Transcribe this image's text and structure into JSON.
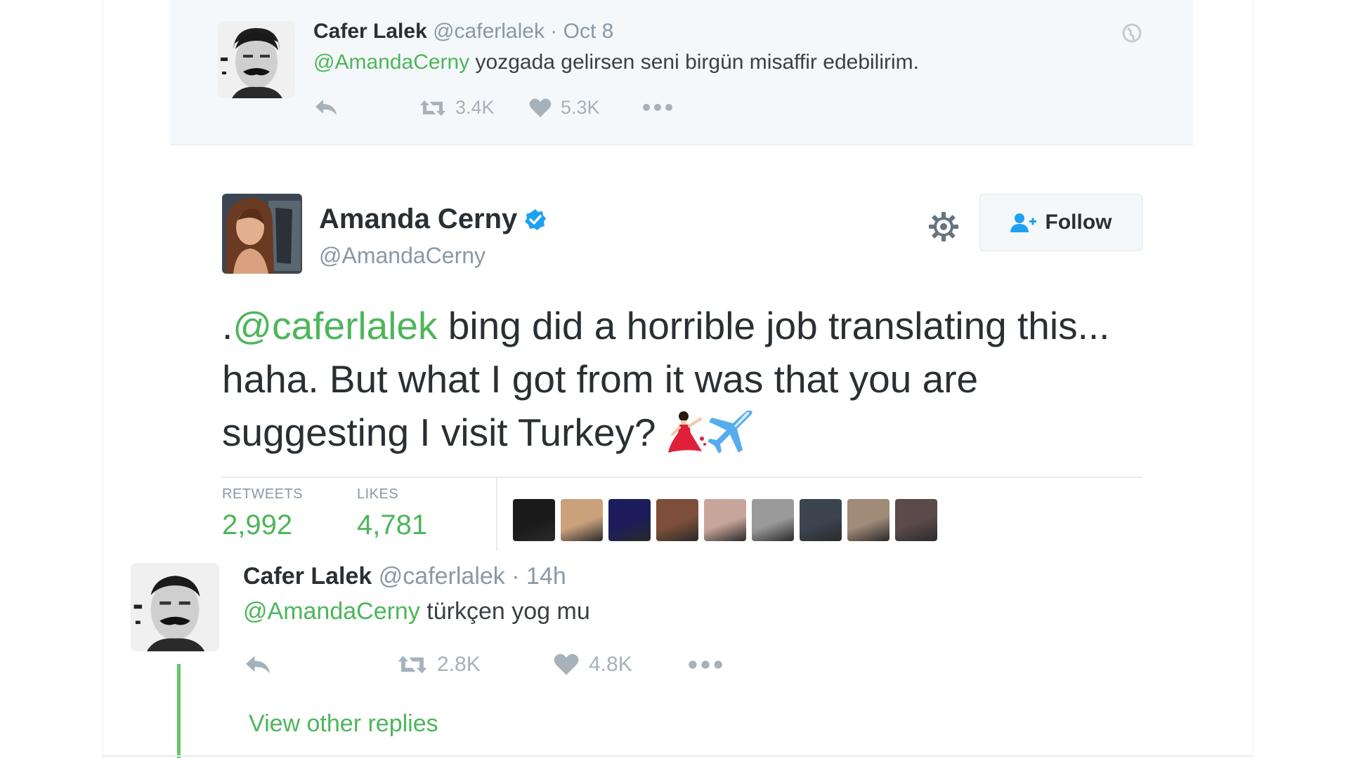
{
  "parent_tweet": {
    "name": "Cafer Lalek",
    "handle": "@caferlalek",
    "separator": "·",
    "time": "Oct 8",
    "mention": "@AmandaCerny",
    "text": " yozgada gelirsen seni birgün misaffir edebilirim.",
    "retweets": "3.4K",
    "likes": "5.3K",
    "icons": {
      "status": "globe-icon",
      "reply": "reply-icon",
      "retweet": "retweet-icon",
      "like": "heart-icon",
      "more": "more-icon"
    }
  },
  "main_tweet": {
    "name": "Amanda Cerny",
    "handle": "@AmandaCerny",
    "follow_label": "Follow",
    "text_prefix": ".",
    "mention": "@caferlalek",
    "text": "  bing did a horrible job translating this... haha. But what I got from it was that you are suggesting I visit Turkey? ",
    "stats": {
      "retweets_label": "RETWEETS",
      "retweets_value": "2,992",
      "likes_label": "LIKES",
      "likes_value": "4,781"
    },
    "icons": {
      "verified": "verified-badge-icon",
      "settings": "gear-icon",
      "follow": "add-user-icon",
      "emoji_1": "dancer-emoji-icon",
      "emoji_2": "airplane-emoji-icon"
    },
    "liker_colors": [
      "#1a1a1a",
      "#c9a27c",
      "#1c1d5a",
      "#7d4f3a",
      "#c8a59a",
      "#9a9a9a",
      "#3c4450",
      "#a08a78",
      "#5a4a4a"
    ]
  },
  "reply_tweet": {
    "name": "Cafer Lalek",
    "handle": "@caferlalek",
    "separator": "·",
    "time": "14h",
    "mention": "@AmandaCerny",
    "text": " türkçen yog mu",
    "retweets": "2.8K",
    "likes": "4.8K",
    "view_other_replies": "View other replies"
  },
  "colors": {
    "link": "#4cb65a",
    "muted": "#8899a6",
    "verified": "#1da1f2",
    "thread_line": "#60c96a"
  }
}
